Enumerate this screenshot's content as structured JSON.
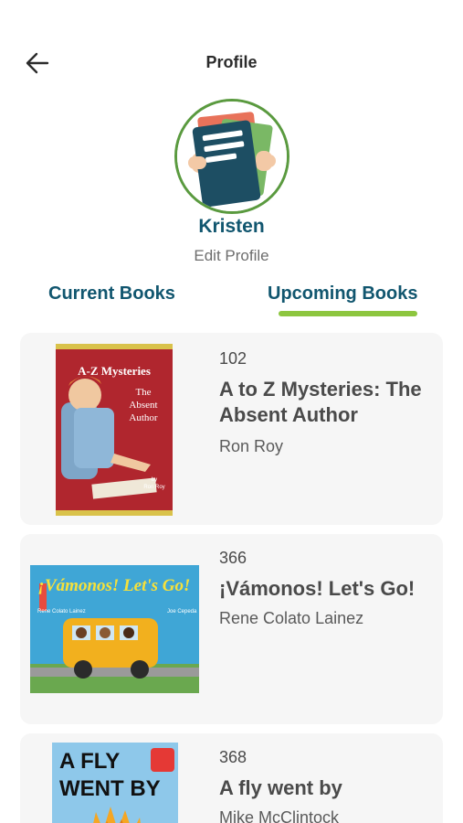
{
  "header": {
    "title": "Profile",
    "back_icon": "arrow-left-icon"
  },
  "profile": {
    "name": "Kristen",
    "edit_label": "Edit Profile",
    "avatar_icon": "books-avatar-icon"
  },
  "tabs": [
    {
      "label": "Current Books",
      "active": false
    },
    {
      "label": "Upcoming Books",
      "active": true
    }
  ],
  "colors": {
    "accent": "#11566f",
    "underline": "#8dc63f",
    "avatar_ring": "#5a9a3f",
    "card_bg": "#f6f6f6"
  },
  "books": [
    {
      "number": "102",
      "title": "A to Z Mysteries: The Absent Author",
      "author": "Ron Roy",
      "cover": {
        "series": "A-Z Mysteries",
        "line1": "The",
        "line2": "Absent",
        "line3": "Author",
        "by": "by",
        "cover_author": "Ron Roy"
      }
    },
    {
      "number": "366",
      "title": "¡Vámonos! Let's Go!",
      "author": "Rene Colato Lainez",
      "cover": {
        "title": "¡Vámonos! Let's Go!",
        "left_credit": "Rene Colato Lainez",
        "right_credit": "Joe Cepeda"
      }
    },
    {
      "number": "368",
      "title": "A fly went by",
      "author": "Mike McClintock",
      "cover": {
        "line1": "A FLY",
        "line2": "WENT BY"
      }
    }
  ]
}
